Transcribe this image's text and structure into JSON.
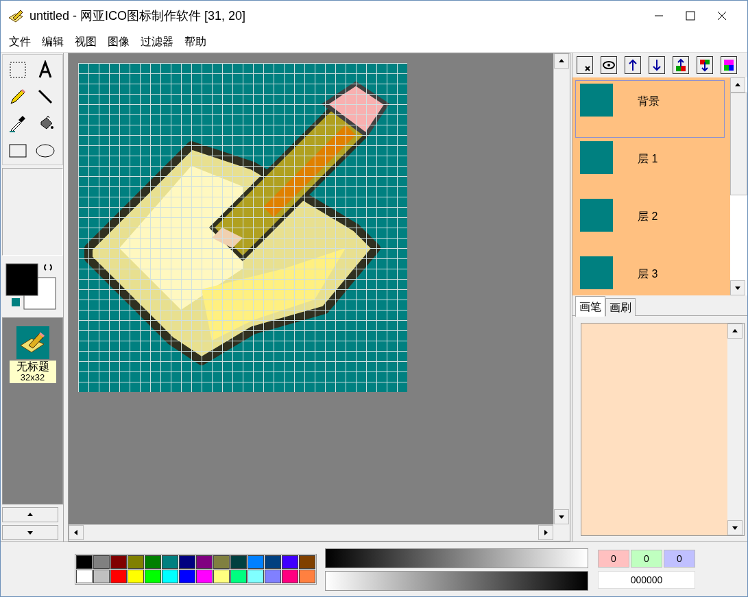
{
  "window": {
    "title": "untitled - 网亚ICO图标制作软件 [31, 20]"
  },
  "menu": [
    "文件",
    "编辑",
    "视图",
    "图像",
    "过滤器",
    "帮助"
  ],
  "icon_list": [
    {
      "name": "无标题",
      "size": "32x32",
      "selected": true
    }
  ],
  "layers": [
    {
      "name": "背景",
      "selected": true
    },
    {
      "name": "层 1",
      "selected": false
    },
    {
      "name": "层 2",
      "selected": false
    },
    {
      "name": "层 3",
      "selected": false
    }
  ],
  "tabs": [
    {
      "label": "画笔",
      "selected": true
    },
    {
      "label": "画刷",
      "selected": false
    }
  ],
  "palette": [
    [
      {
        "color": "#000000"
      },
      {
        "color": "#808080"
      },
      {
        "color": "#800000"
      },
      {
        "color": "#808000"
      },
      {
        "color": "#008000"
      },
      {
        "color": "#008080"
      },
      {
        "color": "#000080"
      },
      {
        "color": "#800080"
      },
      {
        "color": "#808040"
      },
      {
        "color": "#004040"
      },
      {
        "color": "#0080ff"
      },
      {
        "color": "#004080"
      },
      {
        "color": "#4000ff"
      },
      {
        "color": "#804000"
      }
    ],
    [
      {
        "color": "#ffffff"
      },
      {
        "color": "#c0c0c0"
      },
      {
        "color": "#ff0000"
      },
      {
        "color": "#ffff00"
      },
      {
        "color": "#00ff00"
      },
      {
        "color": "#00ffff"
      },
      {
        "color": "#0000ff"
      },
      {
        "color": "#ff00ff"
      },
      {
        "color": "#ffff80"
      },
      {
        "color": "#00ff80"
      },
      {
        "color": "#80ffff"
      },
      {
        "color": "#8080ff"
      },
      {
        "color": "#ff0080"
      },
      {
        "color": "#ff8040"
      }
    ]
  ],
  "rgb": [
    "0",
    "0",
    "0"
  ],
  "hex": "000000"
}
